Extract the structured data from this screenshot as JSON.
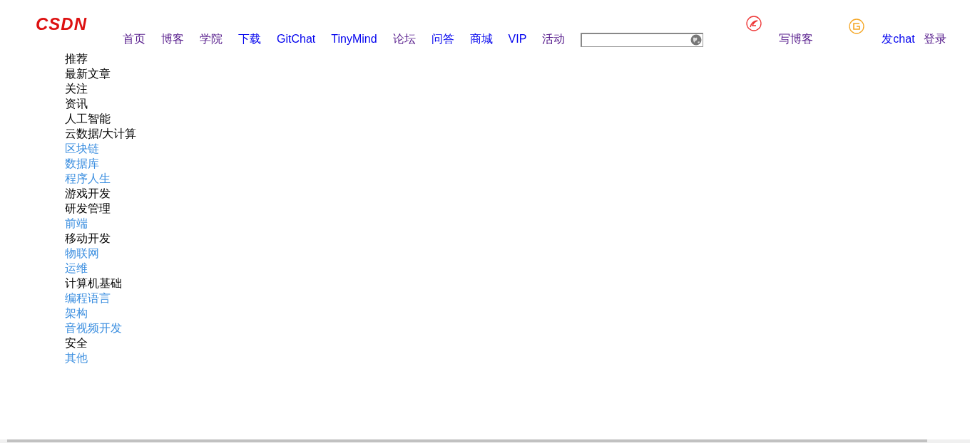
{
  "logo": {
    "text": "CSDN"
  },
  "nav": [
    {
      "label": "首页",
      "visited": true
    },
    {
      "label": "博客",
      "visited": true
    },
    {
      "label": "学院",
      "visited": true
    },
    {
      "label": "下载",
      "visited": false
    },
    {
      "label": "GitChat",
      "visited": false
    },
    {
      "label": "TinyMind",
      "visited": false
    },
    {
      "label": "论坛",
      "visited": true
    },
    {
      "label": "问答",
      "visited": false
    },
    {
      "label": "商城",
      "visited": false
    },
    {
      "label": "VIP",
      "visited": false
    },
    {
      "label": "活动",
      "visited": true
    }
  ],
  "actions": [
    {
      "kind": "write",
      "label": "写博客",
      "visited": true
    },
    {
      "kind": "chat",
      "label": "发chat",
      "visited": false
    },
    {
      "kind": "plain",
      "label": "登录",
      "visited": true
    }
  ],
  "sidebar": {
    "items": [
      {
        "label": "推荐",
        "color": "#000000"
      },
      {
        "label": "最新文章",
        "color": "#000000"
      },
      {
        "label": "关注",
        "color": "#000000"
      },
      {
        "label": "资讯",
        "color": "#000000"
      },
      {
        "label": "人工智能",
        "color": "#000000"
      },
      {
        "label": "云数据/大计算",
        "color": "#000000"
      },
      {
        "label": "区块链",
        "color": "#3c8fe0"
      },
      {
        "label": "数据库",
        "color": "#3c8fe0"
      },
      {
        "label": "程序人生",
        "color": "#3c8fe0"
      },
      {
        "label": "游戏开发",
        "color": "#000000"
      },
      {
        "label": "研发管理",
        "color": "#000000"
      },
      {
        "label": "前端",
        "color": "#3c8fe0"
      },
      {
        "label": "移动开发",
        "color": "#000000"
      },
      {
        "label": "物联网",
        "color": "#3c8fe0"
      },
      {
        "label": "运维",
        "color": "#3c8fe0"
      },
      {
        "label": "计算机基础",
        "color": "#000000"
      },
      {
        "label": "编程语言",
        "color": "#3c8fe0"
      },
      {
        "label": "架构",
        "color": "#3c8fe0"
      },
      {
        "label": "音视频开发",
        "color": "#3c8fe0"
      },
      {
        "label": "安全",
        "color": "#000000"
      },
      {
        "label": "其他",
        "color": "#3c8fe0"
      }
    ]
  }
}
